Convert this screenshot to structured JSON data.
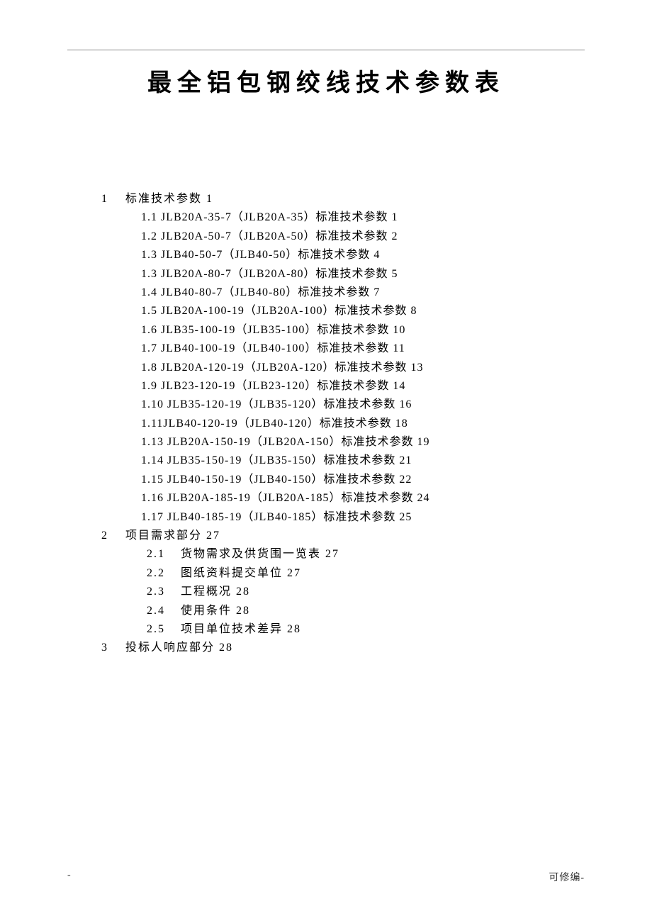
{
  "title": "最全铝包钢绞线技术参数表",
  "sections": [
    {
      "num": "1",
      "label": "标准技术参数 1",
      "items": [
        "1.1 JLB20A-35-7（JLB20A-35）标准技术参数 1",
        "1.2 JLB20A-50-7（JLB20A-50）标准技术参数 2",
        "1.3 JLB40-50-7（JLB40-50）标准技术参数 4",
        "1.3 JLB20A-80-7（JLB20A-80）标准技术参数 5",
        "1.4 JLB40-80-7（JLB40-80）标准技术参数 7",
        "1.5 JLB20A-100-19（JLB20A-100）标准技术参数 8",
        "1.6 JLB35-100-19（JLB35-100）标准技术参数 10",
        "1.7 JLB40-100-19（JLB40-100）标准技术参数 11",
        "1.8 JLB20A-120-19（JLB20A-120）标准技术参数 13",
        "1.9 JLB23-120-19（JLB23-120）标准技术参数 14",
        "1.10 JLB35-120-19（JLB35-120）标准技术参数 16",
        "1.11JLB40-120-19（JLB40-120）标准技术参数 18",
        "1.13 JLB20A-150-19（JLB20A-150）标准技术参数 19",
        "1.14 JLB35-150-19（JLB35-150）标准技术参数 21",
        "1.15 JLB40-150-19（JLB40-150）标准技术参数 22",
        "1.16 JLB20A-185-19（JLB20A-185）标准技术参数 24",
        "1.17 JLB40-185-19（JLB40-185）标准技术参数 25"
      ]
    },
    {
      "num": "2",
      "label": "项目需求部分 27",
      "items2": [
        {
          "num": "2.1",
          "label": "货物需求及供货围一览表 27"
        },
        {
          "num": "2.2",
          "label": "图纸资料提交单位 27"
        },
        {
          "num": "2.3",
          "label": "工程概况 28"
        },
        {
          "num": "2.4",
          "label": "使用条件 28"
        },
        {
          "num": "2.5",
          "label": "项目单位技术差异 28"
        }
      ]
    },
    {
      "num": "3",
      "label": "投标人响应部分 28"
    }
  ],
  "footer": {
    "left": "-",
    "right": "可修编-"
  }
}
